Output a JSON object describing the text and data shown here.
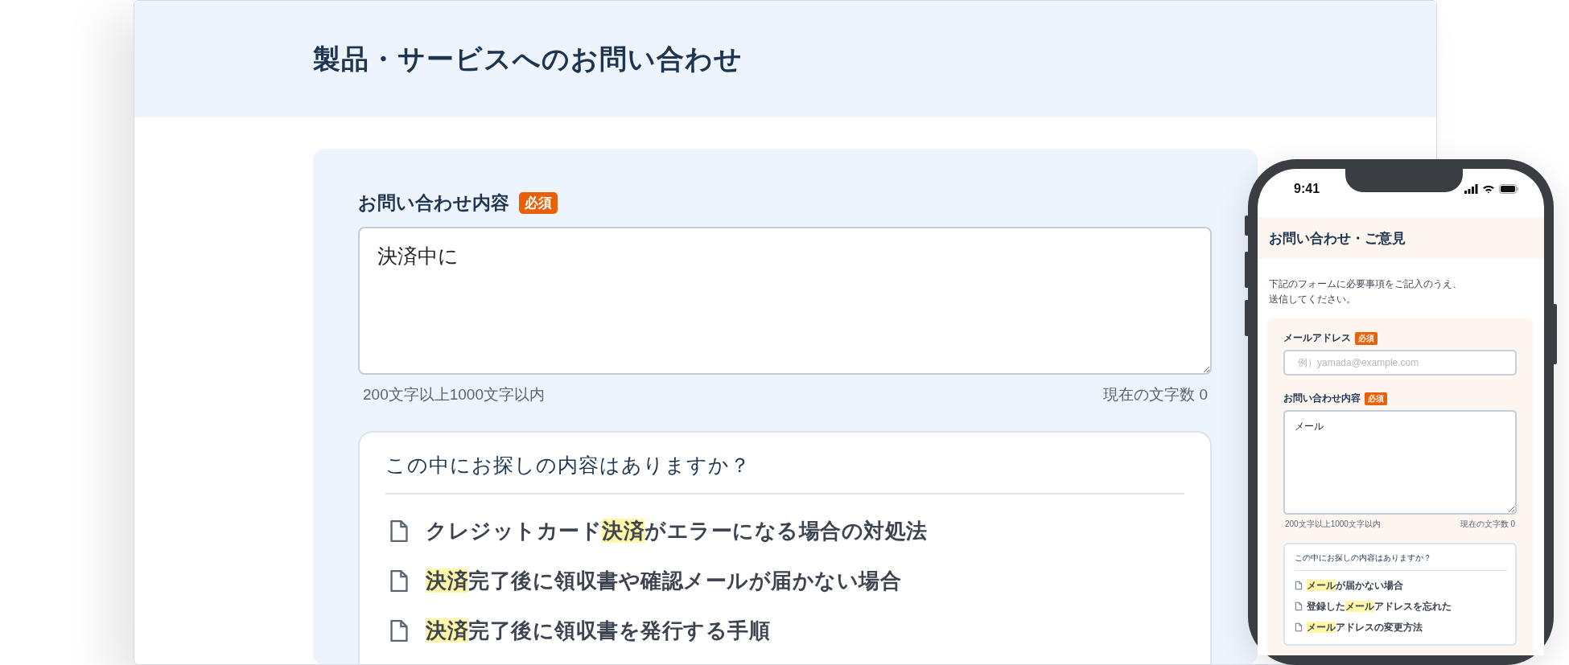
{
  "desktop": {
    "title": "製品・サービスへのお問い合わせ",
    "field": {
      "label": "お問い合わせ内容",
      "badge": "必須",
      "value": "決済中に",
      "limit_hint": "200文字以上1000文字以内",
      "count": "現在の文字数 0"
    },
    "suggestions": {
      "heading": "この中にお探しの内容はありますか？",
      "items": [
        {
          "segments": [
            {
              "text": "クレジットカード",
              "highlighted": false
            },
            {
              "text": "決済",
              "highlighted": true
            },
            {
              "text": "がエラーになる場合の対処法",
              "highlighted": false
            }
          ]
        },
        {
          "segments": [
            {
              "text": "決済",
              "highlighted": true
            },
            {
              "text": "完了後に領収書や確認メールが届かない場合",
              "highlighted": false
            }
          ]
        },
        {
          "segments": [
            {
              "text": "決済",
              "highlighted": true
            },
            {
              "text": "完了後に領収書を発行する手順",
              "highlighted": false
            }
          ]
        }
      ]
    }
  },
  "phone": {
    "time": "9:41",
    "title": "お問い合わせ・ご意見",
    "description": [
      "下記のフォームに必要事項をご記入のうえ、",
      "送信してください。"
    ],
    "email": {
      "label": "メールアドレス",
      "badge": "必須",
      "placeholder": "例）yamada@example.com"
    },
    "field": {
      "label": "お問い合わせ内容",
      "badge": "必須",
      "value": "メール",
      "limit_hint": "200文字以上1000文字以内",
      "count": "現在の文字数 0"
    },
    "suggestions": {
      "heading": "この中にお探しの内容はありますか？",
      "items": [
        {
          "segments": [
            {
              "text": "メール",
              "highlighted": true
            },
            {
              "text": "が届かない場合",
              "highlighted": false
            }
          ]
        },
        {
          "segments": [
            {
              "text": "登録した",
              "highlighted": false
            },
            {
              "text": "メール",
              "highlighted": true
            },
            {
              "text": "アドレスを忘れた",
              "highlighted": false
            }
          ]
        },
        {
          "segments": [
            {
              "text": "メール",
              "highlighted": true
            },
            {
              "text": "アドレスの変更方法",
              "highlighted": false
            }
          ]
        }
      ]
    }
  }
}
